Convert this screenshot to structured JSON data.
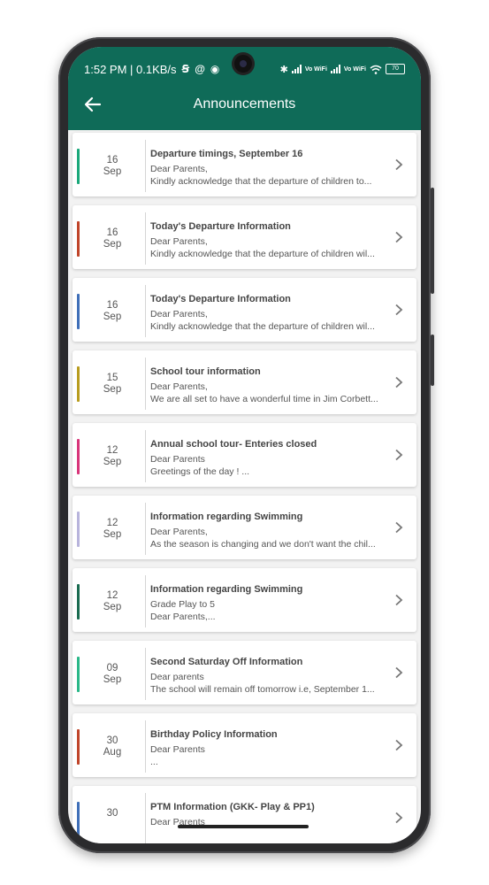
{
  "status_bar": {
    "time_speed": "1:52 PM | 0.1KB/s",
    "icons": [
      "s-icon",
      "at-icon",
      "circle-icon"
    ],
    "vo_wifi": "Vo WiFi",
    "battery": "70"
  },
  "header": {
    "title": "Announcements",
    "bg_color": "#0f6b58"
  },
  "announcements": [
    {
      "day": "16",
      "month": "Sep",
      "title": "Departure timings, September 16",
      "line1": "Dear Parents,",
      "line2": "Kindly acknowledge that the departure of children to...",
      "color": "#1aa87a"
    },
    {
      "day": "16",
      "month": "Sep",
      "title": "Today's Departure Information",
      "line1": "Dear Parents,",
      "line2": "Kindly acknowledge that the departure of children wil...",
      "color": "#c0452a"
    },
    {
      "day": "16",
      "month": "Sep",
      "title": "Today's Departure Information",
      "line1": "Dear Parents,",
      "line2": "Kindly acknowledge that the departure of children wil...",
      "color": "#3f6fb8"
    },
    {
      "day": "15",
      "month": "Sep",
      "title": "School tour information",
      "line1": "Dear Parents,",
      "line2": "We are all set to have a wonderful time in Jim Corbett...",
      "color": "#b89c1e"
    },
    {
      "day": "12",
      "month": "Sep",
      "title": "Annual school tour- Enteries closed",
      "line1": "Dear Parents",
      "line2": "Greetings of the day ! ...",
      "color": "#d8357a"
    },
    {
      "day": "12",
      "month": "Sep",
      "title": "Information regarding Swimming",
      "line1": "Dear Parents,",
      "line2": "As the season is changing and we don't want the chil...",
      "color": "#b8b4dc"
    },
    {
      "day": "12",
      "month": "Sep",
      "title": "Information regarding Swimming",
      "line1": "Grade Play to 5",
      "line2": "Dear Parents,...",
      "color": "#1a6b50"
    },
    {
      "day": "09",
      "month": "Sep",
      "title": "Second Saturday Off Information",
      "line1": "Dear parents",
      "line2": "The school will remain off tomorrow i.e, September 1...",
      "color": "#2ab888"
    },
    {
      "day": "30",
      "month": "Aug",
      "title": "Birthday Policy Information",
      "line1": "Dear Parents",
      "line2": "...",
      "color": "#c0452a"
    },
    {
      "day": "30",
      "month": "",
      "title": "PTM Information (GKK- Play & PP1)",
      "line1": "Dear Parents",
      "line2": "",
      "color": "#3f6fb8"
    }
  ]
}
